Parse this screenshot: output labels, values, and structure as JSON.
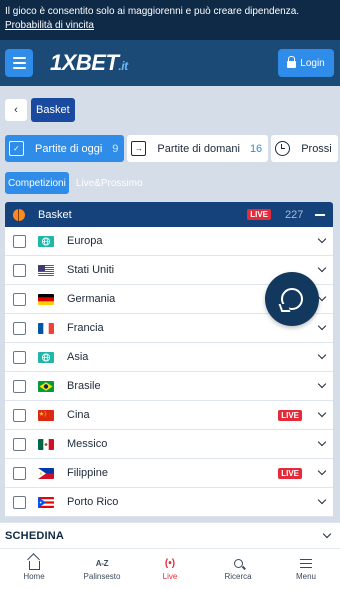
{
  "warning": {
    "text": "Il gioco è consentito solo ai maggiorenni e può creare dipendenza.",
    "link": "Probabilità di vincita"
  },
  "header": {
    "logo": "1XBET",
    "logo_suffix": ".it",
    "login_label": "Login"
  },
  "breadcrumb": {
    "back": "‹",
    "current": "Basket"
  },
  "day_tabs": [
    {
      "label": "Partite di oggi",
      "count": "9"
    },
    {
      "label": "Partite di domani",
      "count": "16"
    },
    {
      "label": "Prossi"
    }
  ],
  "sub_tabs": [
    "Competizioni",
    "Live&Prossimo"
  ],
  "sport": {
    "name": "Basket",
    "live": "LIVE",
    "count": "227"
  },
  "countries": [
    {
      "name": "Europa",
      "flag": "globe",
      "live": ""
    },
    {
      "name": "Stati Uniti",
      "flag": "us",
      "live": ""
    },
    {
      "name": "Germania",
      "flag": "de",
      "live": ""
    },
    {
      "name": "Francia",
      "flag": "fr",
      "live": ""
    },
    {
      "name": "Asia",
      "flag": "globe",
      "live": ""
    },
    {
      "name": "Brasile",
      "flag": "br",
      "live": ""
    },
    {
      "name": "Cina",
      "flag": "cn",
      "live": "LIVE"
    },
    {
      "name": "Messico",
      "flag": "mx",
      "live": ""
    },
    {
      "name": "Filippine",
      "flag": "ph",
      "live": "LIVE"
    },
    {
      "name": "Porto Rico",
      "flag": "pr",
      "live": ""
    }
  ],
  "schedina": "SCHEDINA",
  "bottom_nav": [
    {
      "label": "Home",
      "icon": "home-icon"
    },
    {
      "label": "Palinsesto",
      "icon": "az-icon",
      "glyph": "A-Z"
    },
    {
      "label": "Live",
      "icon": "live-icon",
      "glyph": "(•)"
    },
    {
      "label": "Ricerca",
      "icon": "search-icon"
    },
    {
      "label": "Menu",
      "icon": "menu-icon"
    }
  ],
  "colors": {
    "brand_dark": "#0f2a47",
    "header": "#1a4a75",
    "accent": "#2f8ce8",
    "live": "#e52b3a"
  }
}
